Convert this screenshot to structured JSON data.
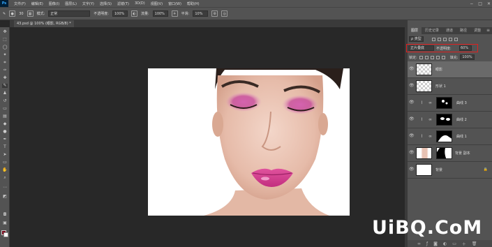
{
  "app": {
    "logo": "Ps"
  },
  "menu": {
    "items": [
      "文件(F)",
      "编辑(E)",
      "图像(I)",
      "图层(L)",
      "文字(Y)",
      "选择(S)",
      "滤镜(T)",
      "3D(D)",
      "视图(V)",
      "窗口(W)",
      "帮助(H)"
    ],
    "window_controls": [
      "−",
      "□",
      "✕"
    ]
  },
  "options": {
    "size_label": "30",
    "mode_label": "模式:",
    "mode_value": "正常",
    "opacity_label": "不透明度:",
    "opacity_value": "100%",
    "flow_label": "流量:",
    "flow_value": "100%",
    "smooth_label": "平滑:",
    "smooth_value": "10%"
  },
  "document": {
    "tab_title": "43.psd @ 100% (眼影, RGB/8) *"
  },
  "panels": {
    "tabs": [
      "图层",
      "历史记录",
      "通道",
      "路径",
      "调整"
    ],
    "active_tab": "图层",
    "filter_label": "ρ 类型",
    "blend_mode": "正片叠底",
    "opacity_label": "不透明度:",
    "opacity_value": "60%",
    "lock_label": "锁定:",
    "fill_label": "填充:",
    "fill_value": "100%"
  },
  "layers": [
    {
      "name": "眼影",
      "selected": true
    },
    {
      "name": "形状 1",
      "selected": false
    },
    {
      "name": "曲线 3",
      "selected": false
    },
    {
      "name": "曲线 2",
      "selected": false
    },
    {
      "name": "曲线 1",
      "selected": false
    },
    {
      "name": "背景 副本",
      "selected": false
    },
    {
      "name": "背景",
      "selected": false
    }
  ],
  "watermark": "UiBQ.CoM",
  "colors": {
    "foreground": "#7a0c1e",
    "background": "#ffffff",
    "highlight": "#e02020"
  }
}
